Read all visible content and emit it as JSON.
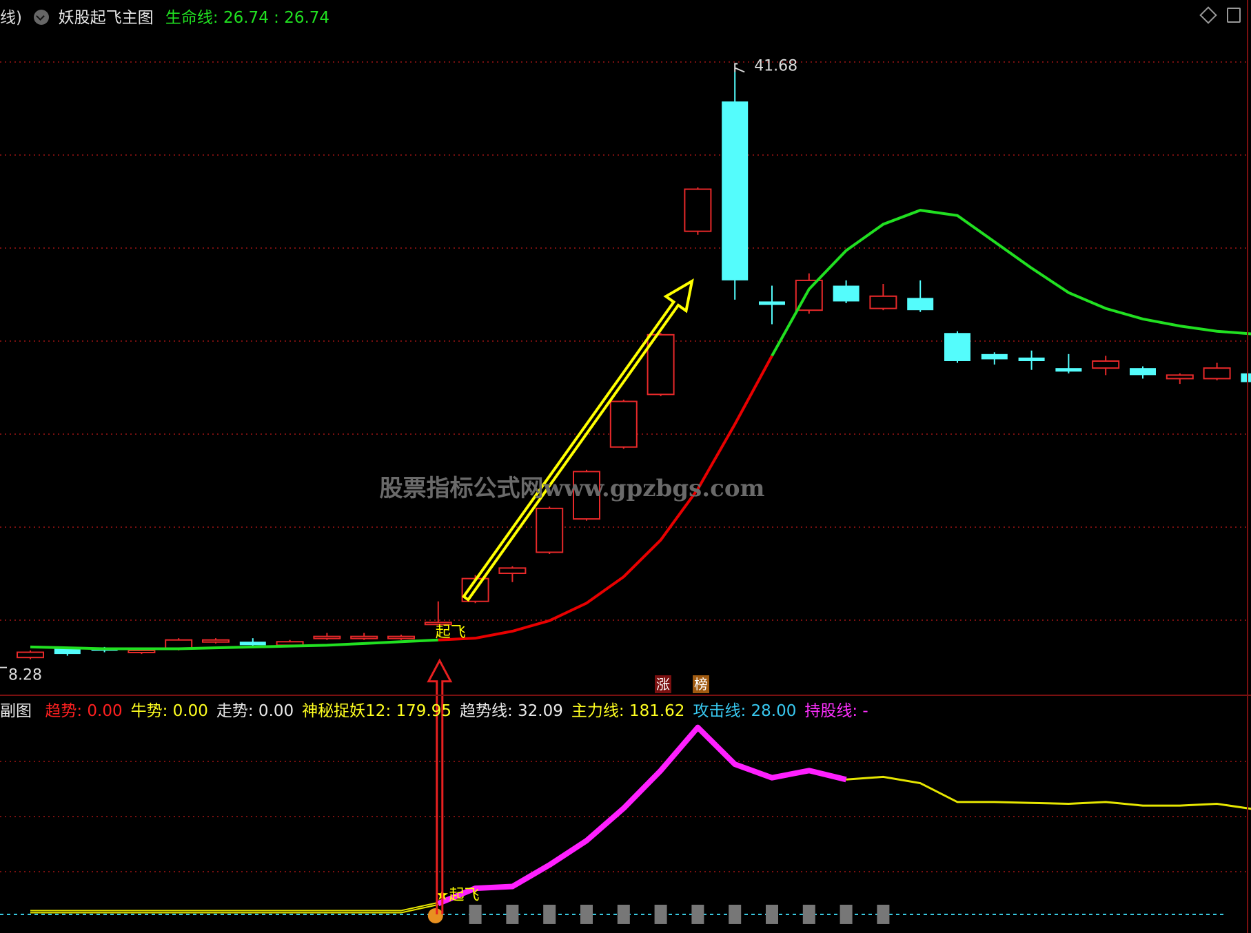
{
  "colors": {
    "background": "#000000",
    "grid": "#7a1010",
    "up_candle": "#e8292a",
    "down_candle": "#54fcfc",
    "life_line_up": "#e80000",
    "life_line_down": "#21e021",
    "arrow_yellow": "#ffff00",
    "signal_arrow": "#e82020",
    "trend_yellow": "#e6e600",
    "magenta": "#ff20ff",
    "watermark": "#6a6a6a",
    "baseline_cyan": "#38c8e0"
  },
  "main_header": {
    "cut_prefix": "线)",
    "menu_icon": "circle-chevron-down-icon",
    "title": "妖股起飞主图",
    "life_line_label": "生命线",
    "life_line_values": ": 26.74 : 26.74"
  },
  "window_controls": {
    "restore_icon": "diamond-icon",
    "max_icon": "square-icon"
  },
  "price_labels": {
    "high": "41.68",
    "low": "8.28"
  },
  "signal_label": "起飞",
  "star_signal_label": "★起飞",
  "watermark": "股票指标公式网www.gpzbgs.com",
  "badges": [
    "涨",
    "榜"
  ],
  "sub_header": {
    "title": "副图",
    "items": [
      {
        "label": "趋势",
        "value": ": 0.00",
        "color": "#ff2020"
      },
      {
        "label": "牛势",
        "value": ": 0.00",
        "color": "#ffff20"
      },
      {
        "label": "走势",
        "value": ": 0.00",
        "color": "#e8e8e8"
      },
      {
        "label": "神秘捉妖12",
        "value": ": 179.95",
        "color": "#ffff20"
      },
      {
        "label": "趋势线",
        "value": ": 32.09",
        "color": "#e8e8e8"
      },
      {
        "label": "主力线",
        "value": ": 181.62",
        "color": "#ffff20"
      },
      {
        "label": "攻击线",
        "value": ": 28.00",
        "color": "#38c8f0"
      },
      {
        "label": "持股线",
        "value": ": -",
        "color": "#ff30ff"
      }
    ]
  },
  "chart_data": [
    {
      "type": "candlestick",
      "title": "妖股起飞主图",
      "ylim": [
        6.5,
        45
      ],
      "high_label": 41.68,
      "low_label": 8.28,
      "candles": [
        {
          "o": 8.3,
          "c": 8.6,
          "h": 8.7,
          "l": 8.2
        },
        {
          "o": 8.8,
          "c": 8.5,
          "h": 8.9,
          "l": 8.4
        },
        {
          "o": 8.8,
          "c": 8.7,
          "h": 8.9,
          "l": 8.6
        },
        {
          "o": 8.6,
          "c": 8.7,
          "h": 8.8,
          "l": 8.5
        },
        {
          "o": 8.8,
          "c": 9.3,
          "h": 9.4,
          "l": 8.7
        },
        {
          "o": 9.2,
          "c": 9.3,
          "h": 9.4,
          "l": 9.1
        },
        {
          "o": 9.2,
          "c": 9.0,
          "h": 9.4,
          "l": 8.9
        },
        {
          "o": 9.0,
          "c": 9.2,
          "h": 9.3,
          "l": 8.9
        },
        {
          "o": 9.4,
          "c": 9.5,
          "h": 9.7,
          "l": 9.3
        },
        {
          "o": 9.4,
          "c": 9.5,
          "h": 9.7,
          "l": 9.3
        },
        {
          "o": 9.4,
          "c": 9.5,
          "h": 9.6,
          "l": 9.3
        },
        {
          "o": 10.3,
          "c": 10.3,
          "h": 11.5,
          "l": 10.2
        },
        {
          "o": 11.5,
          "c": 12.8,
          "h": 13.0,
          "l": 11.4
        },
        {
          "o": 13.1,
          "c": 13.4,
          "h": 13.5,
          "l": 12.6
        },
        {
          "o": 14.3,
          "c": 16.8,
          "h": 16.9,
          "l": 14.2
        },
        {
          "o": 16.2,
          "c": 18.9,
          "h": 19.0,
          "l": 16.1
        },
        {
          "o": 20.3,
          "c": 22.9,
          "h": 23.0,
          "l": 20.2
        },
        {
          "o": 23.3,
          "c": 26.7,
          "h": 26.8,
          "l": 23.2
        },
        {
          "o": 32.6,
          "c": 35.0,
          "h": 35.1,
          "l": 32.4
        },
        {
          "o": 40.0,
          "c": 29.8,
          "h": 41.68,
          "l": 28.7
        },
        {
          "o": 28.6,
          "c": 28.4,
          "h": 29.5,
          "l": 27.3
        },
        {
          "o": 28.1,
          "c": 29.8,
          "h": 30.2,
          "l": 27.9
        },
        {
          "o": 29.5,
          "c": 28.6,
          "h": 29.8,
          "l": 28.5
        },
        {
          "o": 28.2,
          "c": 28.9,
          "h": 29.6,
          "l": 28.1
        },
        {
          "o": 28.8,
          "c": 28.1,
          "h": 29.8,
          "l": 28.0
        },
        {
          "o": 26.8,
          "c": 25.2,
          "h": 26.9,
          "l": 25.1
        },
        {
          "o": 25.6,
          "c": 25.3,
          "h": 25.7,
          "l": 25.0
        },
        {
          "o": 25.4,
          "c": 25.2,
          "h": 25.8,
          "l": 24.7
        },
        {
          "o": 24.8,
          "c": 24.6,
          "h": 25.6,
          "l": 24.5
        },
        {
          "o": 24.8,
          "c": 25.2,
          "h": 25.5,
          "l": 24.4
        },
        {
          "o": 24.8,
          "c": 24.4,
          "h": 24.9,
          "l": 24.2
        },
        {
          "o": 24.2,
          "c": 24.4,
          "h": 24.5,
          "l": 23.9
        },
        {
          "o": 24.2,
          "c": 24.8,
          "h": 25.1,
          "l": 24.1
        },
        {
          "o": 24.5,
          "c": 24.0,
          "h": 24.6,
          "l": 23.8
        }
      ],
      "life_line": [
        8.9,
        8.85,
        8.8,
        8.8,
        8.8,
        8.85,
        8.9,
        8.95,
        9.0,
        9.1,
        9.2,
        9.3,
        9.4,
        9.8,
        10.4,
        11.4,
        12.9,
        15.0,
        17.9,
        21.6,
        25.5,
        29.3,
        31.5,
        33.0,
        33.8,
        33.5,
        32.0,
        30.5,
        29.1,
        28.2,
        27.6,
        27.2,
        26.9,
        26.74
      ],
      "life_line_up_range": [
        11,
        20
      ]
    },
    {
      "type": "line",
      "title": "副图",
      "ylim": [
        -10,
        220
      ],
      "trend_line": [
        3,
        3,
        3,
        3,
        3,
        3,
        3,
        3,
        3,
        3,
        3,
        12,
        29,
        31,
        55,
        82,
        118,
        160,
        208,
        167,
        152,
        160,
        150,
        153,
        146,
        125,
        125,
        124,
        123,
        125,
        121,
        121,
        123,
        117
      ],
      "magenta_range": [
        11,
        22
      ],
      "baseline": 0,
      "signal_index": 11,
      "markers_indices": [
        12,
        13,
        14,
        15,
        16,
        17,
        18,
        19,
        20,
        21,
        22,
        23
      ]
    }
  ]
}
